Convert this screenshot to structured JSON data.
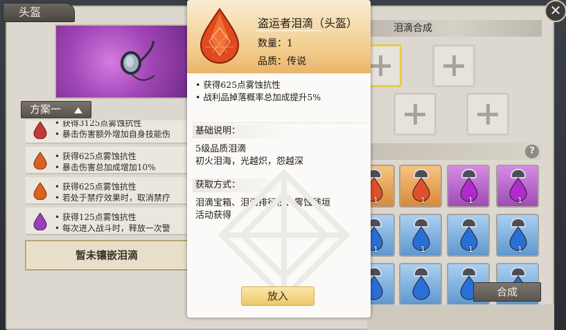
{
  "window": {
    "title_tab": "头盔",
    "close_label": "✕"
  },
  "left": {
    "scheme_dropdown": "方案一",
    "list_items": [
      {
        "gem_color": "#c23a3a",
        "line1": "• 获得3125点雾蚀抗性",
        "line2": "• 暴击伤害额外增加自身技能伤"
      },
      {
        "gem_color": "#d8631f",
        "line1": "• 获得625点雾蚀抗性",
        "line2": "• 暴击伤害总加成增加10%"
      },
      {
        "gem_color": "#d8631f",
        "line1": "• 获得625点雾蚀抗性",
        "line2": "• 若处于禁疗效果时，取消禁疗"
      },
      {
        "gem_color": "#9b3fb8",
        "line1": "• 获得125点雾蚀抗性",
        "line2": "• 每次进入战斗时，释放一次警"
      }
    ],
    "empty_slot_label": "暂未镶嵌泪滴"
  },
  "right": {
    "header": "泪滴合成",
    "inventory": [
      {
        "color": "orange",
        "count": "1",
        "gem": "#e0502a"
      },
      {
        "color": "orange",
        "count": "1",
        "gem": "#e0502a"
      },
      {
        "color": "purple",
        "count": "1",
        "gem": "#b02ad0"
      },
      {
        "color": "purple",
        "count": "1",
        "gem": "#b02ad0"
      },
      {
        "color": "blue",
        "count": "1",
        "gem": "#2a6fd6"
      },
      {
        "color": "blue",
        "count": "1",
        "gem": "#2a6fd6"
      },
      {
        "color": "blue",
        "count": "1",
        "gem": "#2a6fd6"
      },
      {
        "color": "blue",
        "count": "1",
        "gem": "#2a6fd6"
      },
      {
        "color": "blue",
        "count": "",
        "gem": "#2a6fd6"
      },
      {
        "color": "blue",
        "count": "",
        "gem": "#2a6fd6"
      },
      {
        "color": "blue",
        "count": "",
        "gem": "#2a6fd6"
      },
      {
        "color": "blue",
        "count": "",
        "gem": "#2a6fd6"
      }
    ],
    "help_icon": "?",
    "combine_label": "合成"
  },
  "tooltip": {
    "name": "盗运者泪滴（头盔）",
    "quantity": "数量：1",
    "quality": "品质：传说",
    "effects": [
      "• 获得625点雾蚀抗性",
      "• 战利品掉落概率总加成提升5%"
    ],
    "basic_title": "基础说明：",
    "basic_lines": [
      "5级品质泪滴",
      "初火泪海，光越炽，怨越深"
    ],
    "obtain_title": "获取方式：",
    "obtain_lines": [
      "泪滴宝箱、泪滴排行榜、雾蚀残垣",
      "活动获得"
    ],
    "place_label": "放入",
    "gem_color": "#e04a1e"
  }
}
